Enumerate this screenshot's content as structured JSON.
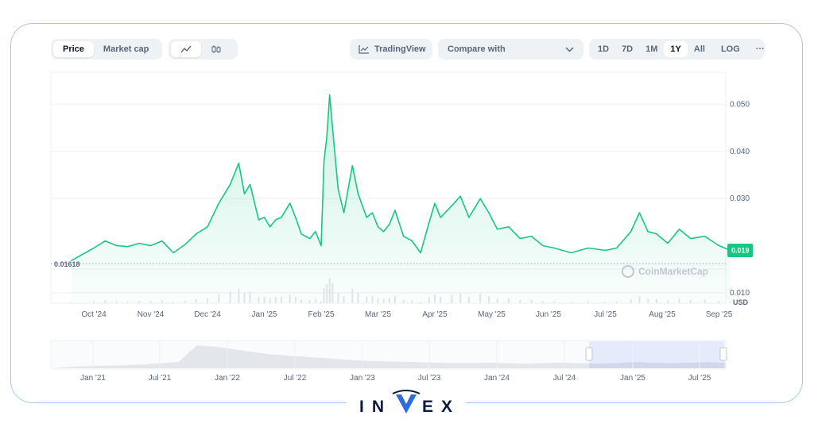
{
  "toolbar": {
    "view_tabs": [
      "Price",
      "Market cap"
    ],
    "active_view": "Price",
    "tradingview_label": "TradingView",
    "compare_label": "Compare with",
    "timeframes": [
      "1D",
      "7D",
      "1M",
      "1Y",
      "All"
    ],
    "active_timeframe": "1Y",
    "log_label": "LOG",
    "more_label": "···"
  },
  "watermark": "CoinMarketCap",
  "brand_logo_text": "INVEX",
  "colors": {
    "line": "#16c784",
    "accent": "#3861fb",
    "watermark": "#c2c8d0"
  },
  "chart_data": [
    {
      "type": "line",
      "currency_label": "USD",
      "x_tick_labels": [
        "Oct '24",
        "Nov '24",
        "Dec '24",
        "Jan '25",
        "Feb '25",
        "Mar '25",
        "Apr '25",
        "May '25",
        "Jun '25",
        "Jul '25",
        "Aug '25",
        "Sep '25"
      ],
      "y_tick_labels": [
        "0.050",
        "0.040",
        "0.030",
        "0.010"
      ],
      "ylim": [
        0.0078,
        0.0568
      ],
      "y_axis_side": "right",
      "baseline_value": 0.01618,
      "baseline_label": "0.01618",
      "current_value": 0.019,
      "current_value_label": "0.019",
      "x_months": [
        -0.4,
        0.0,
        0.2,
        0.4,
        0.6,
        0.8,
        1.0,
        1.2,
        1.4,
        1.6,
        1.8,
        2.0,
        2.2,
        2.4,
        2.55,
        2.65,
        2.75,
        2.9,
        3.0,
        3.1,
        3.2,
        3.3,
        3.45,
        3.55,
        3.65,
        3.8,
        3.9,
        4.0,
        4.05,
        4.1,
        4.15,
        4.2,
        4.3,
        4.4,
        4.55,
        4.65,
        4.8,
        4.9,
        5.0,
        5.1,
        5.2,
        5.3,
        5.45,
        5.6,
        5.75,
        5.9,
        6.0,
        6.1,
        6.3,
        6.45,
        6.6,
        6.8,
        6.95,
        7.1,
        7.3,
        7.5,
        7.7,
        7.9,
        8.1,
        8.4,
        8.7,
        9.0,
        9.2,
        9.45,
        9.6,
        9.75,
        9.9,
        10.1,
        10.3,
        10.5,
        10.75,
        11.0,
        11.2
      ],
      "values": [
        0.0168,
        0.0195,
        0.021,
        0.02,
        0.0198,
        0.0205,
        0.02,
        0.021,
        0.0185,
        0.0202,
        0.0225,
        0.024,
        0.029,
        0.033,
        0.0375,
        0.031,
        0.033,
        0.0255,
        0.026,
        0.024,
        0.0255,
        0.026,
        0.029,
        0.026,
        0.0225,
        0.0215,
        0.023,
        0.02,
        0.038,
        0.043,
        0.052,
        0.045,
        0.032,
        0.027,
        0.037,
        0.031,
        0.026,
        0.027,
        0.024,
        0.023,
        0.0245,
        0.0275,
        0.022,
        0.021,
        0.0185,
        0.025,
        0.029,
        0.026,
        0.0285,
        0.0305,
        0.026,
        0.03,
        0.027,
        0.0235,
        0.024,
        0.0215,
        0.022,
        0.02,
        0.0195,
        0.0185,
        0.0195,
        0.019,
        0.0195,
        0.023,
        0.027,
        0.023,
        0.0225,
        0.0205,
        0.0235,
        0.0215,
        0.022,
        0.02,
        0.019
      ]
    },
    {
      "type": "area",
      "role": "navigator",
      "x_tick_labels": [
        "Jan '21",
        "Jul '21",
        "Jan '22",
        "Jul '22",
        "Jan '23",
        "Jul '23",
        "Jan '24",
        "Jul '24",
        "Jan '25",
        "Jul '25"
      ]
    }
  ]
}
